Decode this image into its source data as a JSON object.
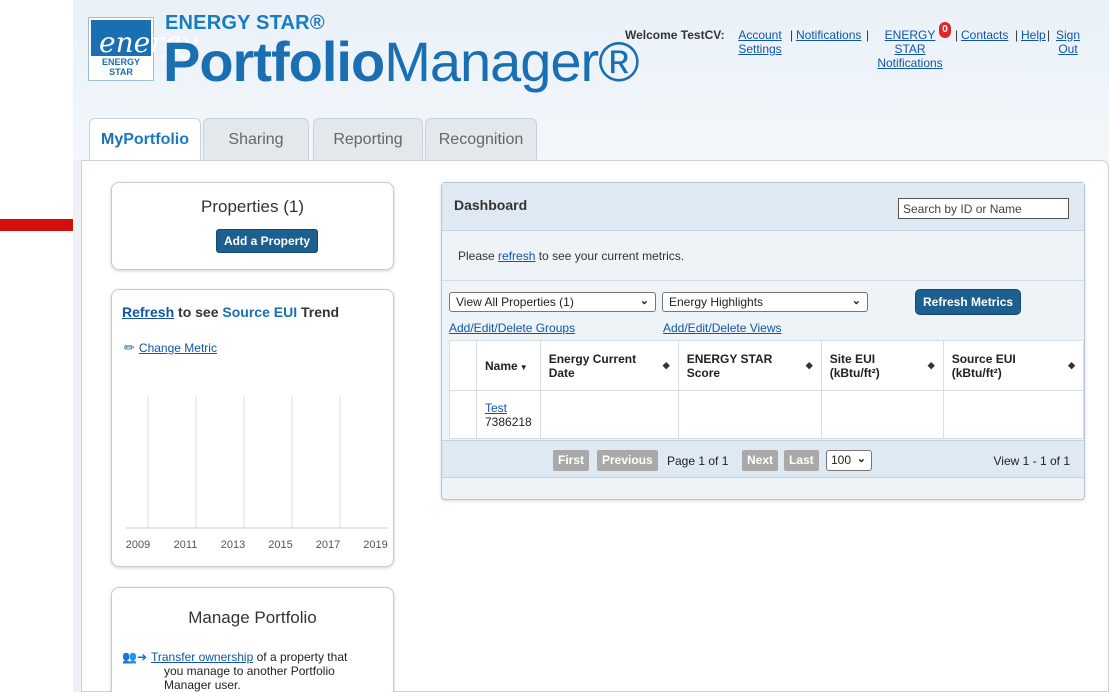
{
  "brand": {
    "top": "ENERGY STAR®",
    "main_bold": "Portfolio",
    "main_light": "Manager®",
    "logo_label": "ENERGY STAR",
    "logo_script": "energy"
  },
  "usernav": {
    "welcome": "Welcome TestCV:",
    "account": "Account Settings",
    "notifications": "Notifications",
    "energy_star_notifications": "ENERGY STAR Notifications",
    "badge_count": "0",
    "contacts": "Contacts",
    "help": "Help",
    "sign_out": "Sign Out"
  },
  "tabs": [
    {
      "label_a": "My",
      "label_b": "Portfolio",
      "active": true
    },
    {
      "label": "Sharing"
    },
    {
      "label": "Reporting"
    },
    {
      "label": "Recognition"
    }
  ],
  "properties": {
    "title": "Properties (1)",
    "add_button": "Add a Property"
  },
  "trend": {
    "refresh_link": "Refresh",
    "mid": " to see ",
    "metric": "Source EUI",
    "suffix": " Trend",
    "change_metric": "Change Metric",
    "years": [
      "2009",
      "2011",
      "2013",
      "2015",
      "2017",
      "2019"
    ]
  },
  "manage": {
    "title": "Manage Portfolio",
    "transfer_link": "Transfer ownership",
    "transfer_text_1": " of a property that",
    "transfer_text_2": "you manage to another Portfolio",
    "transfer_text_3": "Manager user."
  },
  "dashboard": {
    "title": "Dashboard",
    "search_placeholder": "Search by ID or Name",
    "refresh_msg_pre": "Please ",
    "refresh_link": "refresh",
    "refresh_msg_post": " to see your current metrics.",
    "filter_select": "View All Properties (1)",
    "view_select": "Energy Highlights",
    "refresh_metrics_button": "Refresh Metrics",
    "link_groups": "Add/Edit/Delete Groups",
    "link_views": "Add/Edit/Delete Views",
    "columns": {
      "name": "Name",
      "energy_date_1": "Energy Current",
      "energy_date_2": "Date",
      "score_1": "ENERGY STAR",
      "score_2": "Score",
      "site_1": "Site EUI",
      "site_2": "(kBtu/ft²)",
      "source_1": "Source EUI",
      "source_2": "(kBtu/ft²)"
    },
    "rows": [
      {
        "name": "Test",
        "id": "7386218",
        "energy_date": "",
        "score": "",
        "site_eui": "",
        "source_eui": ""
      }
    ],
    "pager": {
      "first": "First",
      "previous": "Previous",
      "page_info": "Page 1 of 1",
      "next": "Next",
      "last": "Last",
      "page_size": "100",
      "view_info": "View 1 - 1 of 1"
    }
  },
  "colors": {
    "brand_blue": "#1a6fb3",
    "button_blue": "#1d5f8f",
    "arrow_red": "#d40d0d"
  }
}
